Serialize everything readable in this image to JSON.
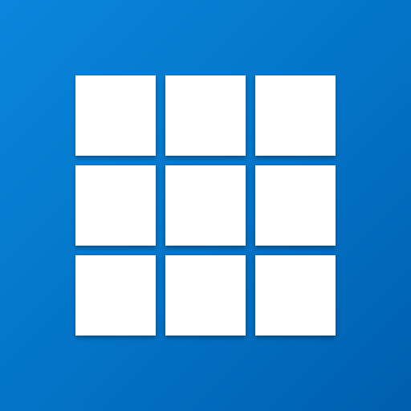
{
  "icon": {
    "name": "grid-tiles-app-icon",
    "background_colors": [
      "#0a86dc",
      "#0373c6",
      "#005fae"
    ],
    "tile_color": "#ffffff",
    "grid": {
      "rows": 3,
      "columns": 3
    }
  }
}
